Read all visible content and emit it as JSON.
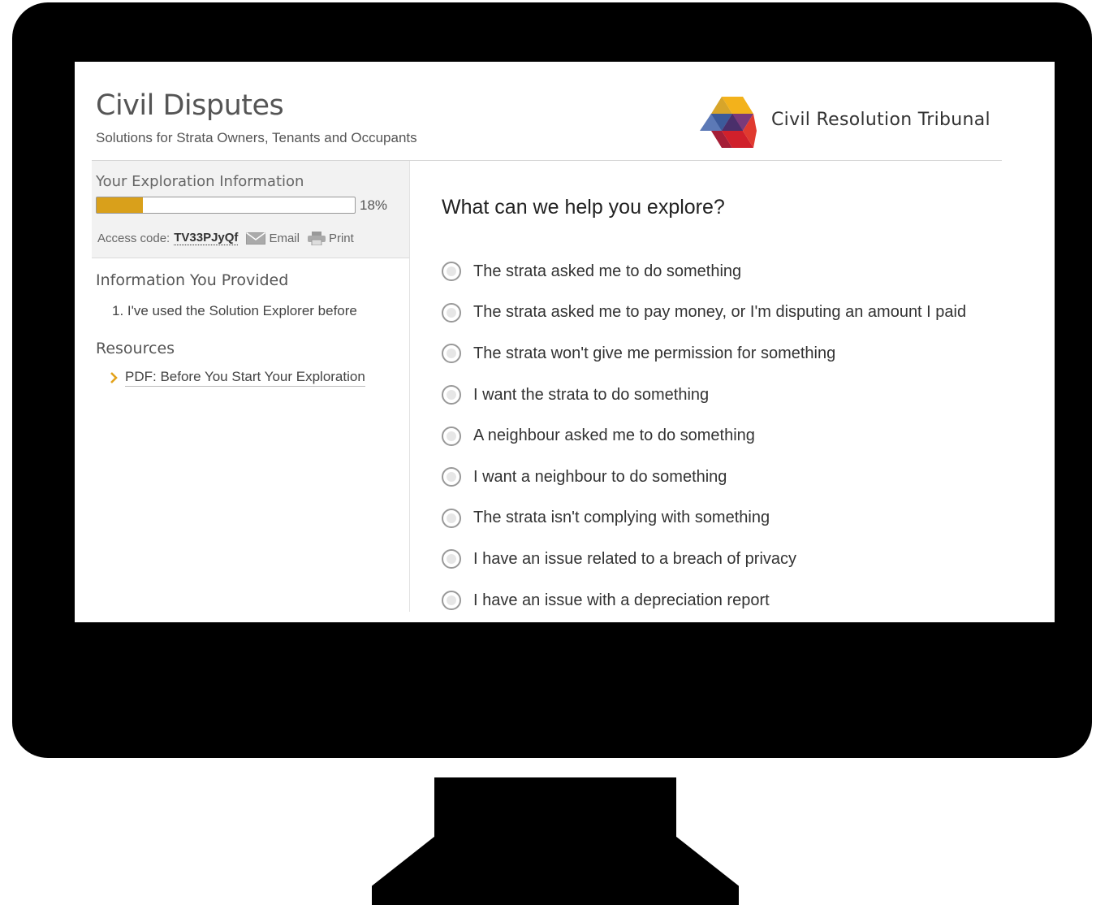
{
  "app": {
    "title": "Civil Disputes",
    "subtitle": "Solutions for Strata Owners, Tenants and Occupants",
    "org_name": "Civil Resolution Tribunal"
  },
  "sidebar": {
    "progress_title": "Your Exploration Information",
    "progress_percent": 18,
    "progress_label": "18%",
    "access_code_label": "Access code:",
    "access_code": "TV33PJyQf",
    "email_label": "Email",
    "print_label": "Print",
    "provided_title": "Information You Provided",
    "provided_items": [
      "1. I've used the Solution Explorer before"
    ],
    "resources_title": "Resources",
    "resources": [
      "PDF: Before You Start Your Exploration"
    ]
  },
  "main": {
    "question": "What can we help you explore?",
    "options": [
      "The strata asked me to do something",
      "The strata asked me to pay money, or I'm disputing an amount I paid",
      "The strata won't give me permission for something",
      "I want the strata to do something",
      "A neighbour asked me to do something",
      "I want a neighbour to do something",
      "The strata isn't complying with something",
      "I have an issue related to a breach of privacy",
      "I have an issue with a depreciation report"
    ]
  },
  "colors": {
    "progress_fill": "#d9a01b",
    "chevron": "#e3a21a",
    "logo_yellow": "#f3b21b",
    "logo_blue": "#3c5a9a",
    "logo_red": "#d0202b"
  },
  "icons": [
    "email-icon",
    "print-icon",
    "chevron-right-icon",
    "radio-icon"
  ]
}
